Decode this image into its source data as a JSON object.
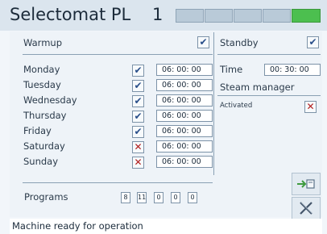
{
  "header": {
    "title": "Selectomat PL",
    "program_number": "1",
    "segments": [
      {
        "state": "inactive"
      },
      {
        "state": "inactive"
      },
      {
        "state": "inactive"
      },
      {
        "state": "inactive"
      },
      {
        "state": "active"
      }
    ]
  },
  "warmup": {
    "label": "Warmup",
    "checked": true,
    "days": [
      {
        "label": "Monday",
        "checked": true,
        "time": "06: 00: 00"
      },
      {
        "label": "Tuesday",
        "checked": true,
        "time": "06: 00: 00"
      },
      {
        "label": "Wednesday",
        "checked": true,
        "time": "06: 00: 00"
      },
      {
        "label": "Thursday",
        "checked": true,
        "time": "06: 00: 00"
      },
      {
        "label": "Friday",
        "checked": true,
        "time": "06: 00: 00"
      },
      {
        "label": "Saturday",
        "checked": false,
        "time": "06: 00: 00"
      },
      {
        "label": "Sunday",
        "checked": false,
        "time": "06: 00: 00"
      }
    ]
  },
  "standby": {
    "label": "Standby",
    "checked": true,
    "time_label": "Time",
    "time_value": "00: 30: 00"
  },
  "steam_manager": {
    "label": "Steam manager",
    "activated_label": "Activated",
    "activated": false
  },
  "programs": {
    "label": "Programs",
    "values": [
      "8",
      "11",
      "0",
      "0",
      "0"
    ]
  },
  "status": {
    "message": "Machine ready for operation"
  },
  "icons": {
    "check": "✔",
    "cross": "✕",
    "export": "export-icon",
    "close": "close-icon"
  },
  "colors": {
    "active_segment": "#4cbf4f",
    "inactive_segment": "#b9cad8",
    "cross_red": "#b01c1c",
    "check_blue": "#2a4f8a"
  }
}
